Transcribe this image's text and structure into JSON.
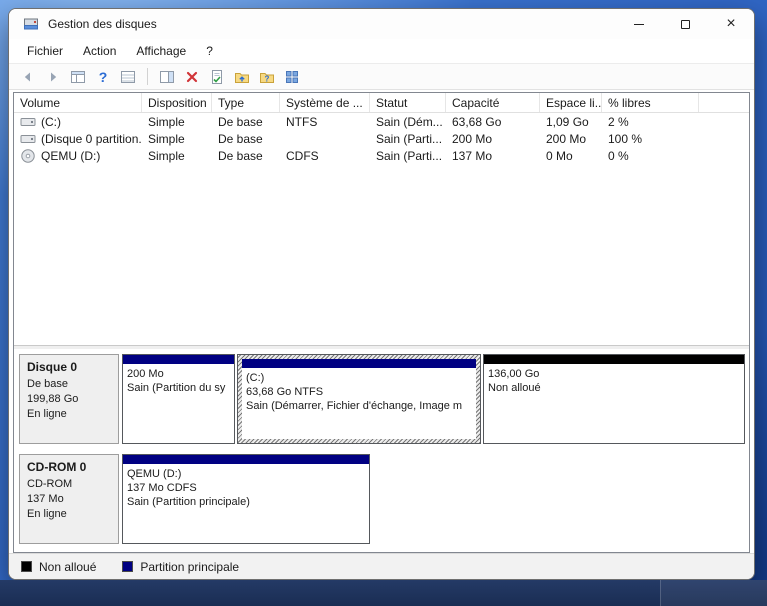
{
  "window": {
    "title": "Gestion des disques"
  },
  "menubar": {
    "items": [
      "Fichier",
      "Action",
      "Affichage",
      "?"
    ]
  },
  "toolbar": {
    "icons": [
      "back",
      "forward",
      "console-tree",
      "help",
      "list-view",
      "separator",
      "action-pane",
      "delete",
      "properties-check",
      "folder-up",
      "folder-help",
      "grid-view"
    ]
  },
  "volumes_table": {
    "columns": [
      "Volume",
      "Disposition",
      "Type",
      "Système de ...",
      "Statut",
      "Capacité",
      "Espace li...",
      "% libres"
    ],
    "rows": [
      {
        "volume": "(C:)",
        "disposition": "Simple",
        "type": "De base",
        "filesystem": "NTFS",
        "status": "Sain (Dém...",
        "capacity": "63,68 Go",
        "free_space": "1,09 Go",
        "percent_free": "2 %"
      },
      {
        "volume": "(Disque 0 partition...",
        "disposition": "Simple",
        "type": "De base",
        "filesystem": "",
        "status": "Sain (Parti...",
        "capacity": "200 Mo",
        "free_space": "200 Mo",
        "percent_free": "100 %"
      },
      {
        "volume": "QEMU (D:)",
        "disposition": "Simple",
        "type": "De base",
        "filesystem": "CDFS",
        "status": "Sain (Parti...",
        "capacity": "137 Mo",
        "free_space": "0 Mo",
        "percent_free": "0 %"
      }
    ]
  },
  "graph": {
    "disks": [
      {
        "panel": {
          "name": "Disque 0",
          "lines": [
            "De base",
            "199,88 Go",
            "En ligne"
          ]
        },
        "partitions": [
          {
            "lines": [
              "200 Mo",
              "Sain (Partition du sy"
            ],
            "color": "#000082",
            "selected": false
          },
          {
            "lines": [
              "(C:)",
              "63,68 Go NTFS",
              "Sain (Démarrer, Fichier d'échange, Image m"
            ],
            "color": "#000082",
            "selected": true
          },
          {
            "lines": [
              "136,00 Go",
              "Non alloué"
            ],
            "color": "#000000",
            "selected": false
          }
        ]
      },
      {
        "panel": {
          "name": "CD-ROM 0",
          "lines": [
            "CD-ROM",
            "137 Mo",
            "En ligne"
          ]
        },
        "partitions": [
          {
            "lines": [
              "QEMU  (D:)",
              "137 Mo CDFS",
              "Sain (Partition principale)"
            ],
            "color": "#000082",
            "selected": false
          }
        ]
      }
    ]
  },
  "legend": {
    "items": [
      {
        "label": "Non alloué",
        "color": "#000000"
      },
      {
        "label": "Partition principale",
        "color": "#000082"
      }
    ]
  },
  "colors": {
    "partition_primary": "#000082",
    "unallocated": "#000000",
    "selection_hatch": "#777777",
    "desktop_blue": "#2e63c2"
  }
}
